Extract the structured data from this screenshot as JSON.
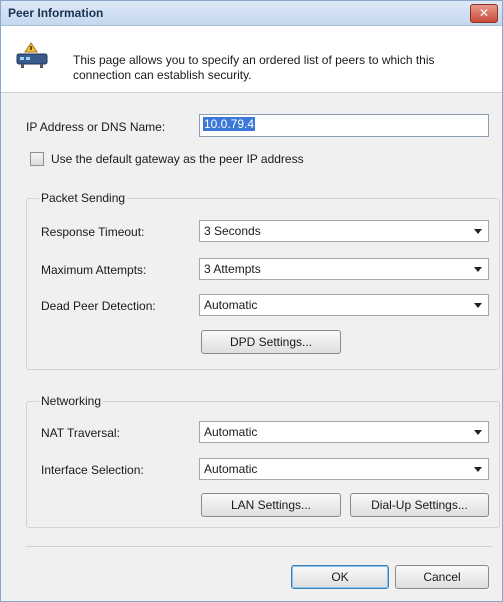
{
  "window": {
    "title": "Peer Information",
    "close_label": "✕"
  },
  "header": {
    "description": "This page allows you to specify an ordered list of peers to which this connection can establish security."
  },
  "ip_field": {
    "label": "IP Address or DNS Name:",
    "value": "10.0.79.4"
  },
  "gateway_checkbox": {
    "label": "Use the default gateway as the peer IP address",
    "checked": false
  },
  "packet_sending": {
    "title": "Packet Sending",
    "response_timeout": {
      "label": "Response Timeout:",
      "value": "3 Seconds"
    },
    "max_attempts": {
      "label": "Maximum Attempts:",
      "value": "3 Attempts"
    },
    "dead_peer": {
      "label": "Dead Peer Detection:",
      "value": "Automatic"
    },
    "dpd_button": "DPD Settings..."
  },
  "networking": {
    "title": "Networking",
    "nat_traversal": {
      "label": "NAT Traversal:",
      "value": "Automatic"
    },
    "interface_selection": {
      "label": "Interface Selection:",
      "value": "Automatic"
    },
    "lan_button": "LAN Settings...",
    "dialup_button": "Dial-Up Settings..."
  },
  "footer": {
    "ok": "OK",
    "cancel": "Cancel"
  },
  "icons": {
    "header_icon": "network-device-icon",
    "close": "close-icon",
    "dropdown": "chevron-down-icon"
  },
  "colors": {
    "close_button": "#c74c3b",
    "selection_highlight": "#3b78d8"
  }
}
